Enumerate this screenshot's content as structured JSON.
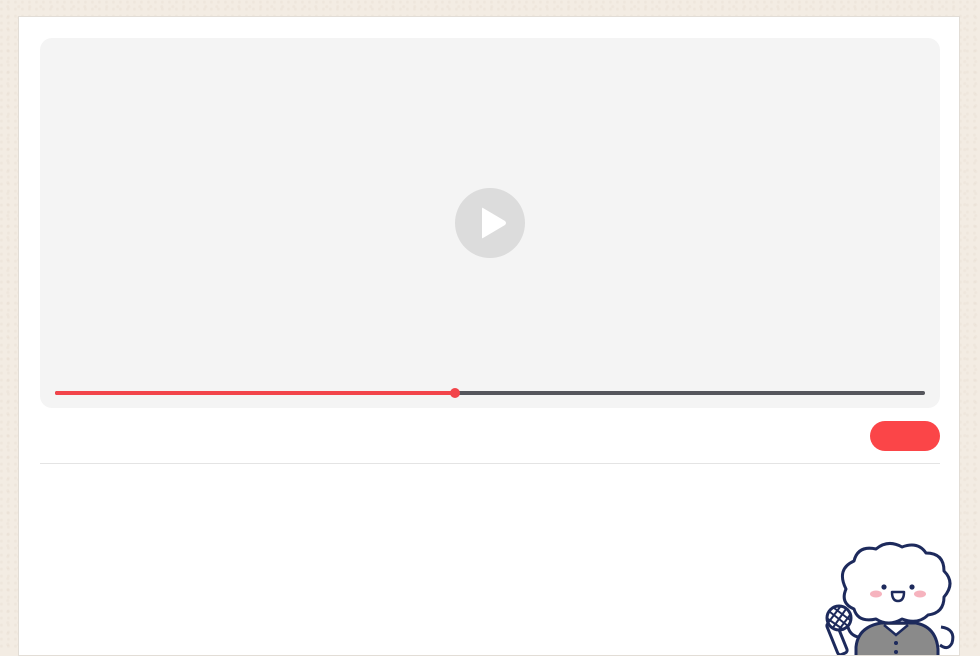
{
  "player": {
    "progress_fraction": 0.46,
    "play_icon": "play-icon",
    "progress_color": "#f2444a",
    "track_color": "#55565c"
  },
  "action_button": {
    "label": "",
    "color": "#fb4548"
  },
  "mascot": {
    "icon": "mascot-with-microphone-icon"
  }
}
